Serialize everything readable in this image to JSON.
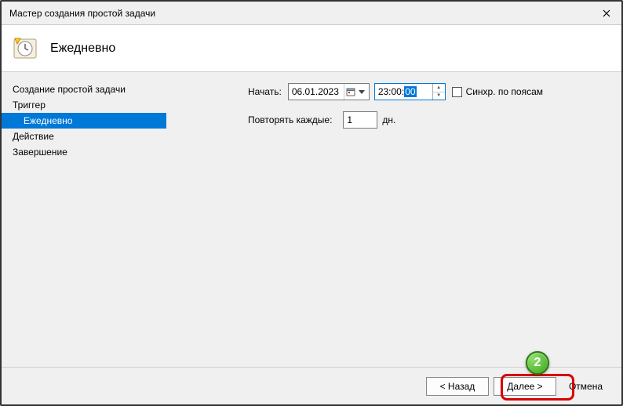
{
  "window": {
    "title": "Мастер создания простой задачи"
  },
  "header": {
    "title": "Ежедневно"
  },
  "sidebar": {
    "items": [
      {
        "label": "Создание простой задачи",
        "selected": false,
        "indent": false
      },
      {
        "label": "Триггер",
        "selected": false,
        "indent": false
      },
      {
        "label": "Ежедневно",
        "selected": true,
        "indent": true
      },
      {
        "label": "Действие",
        "selected": false,
        "indent": false
      },
      {
        "label": "Завершение",
        "selected": false,
        "indent": false
      }
    ]
  },
  "form": {
    "start_label": "Начать:",
    "date_value": "06.01.2023",
    "time_prefix": "23:00:",
    "time_selected": "00",
    "sync_label": "Синхр. по поясам",
    "sync_checked": false,
    "repeat_label": "Повторять каждые:",
    "repeat_value": "1",
    "repeat_unit": "дн."
  },
  "footer": {
    "back": "< Назад",
    "next": "Далее >",
    "cancel": "Отмена"
  },
  "annotation": {
    "badge": "2"
  }
}
